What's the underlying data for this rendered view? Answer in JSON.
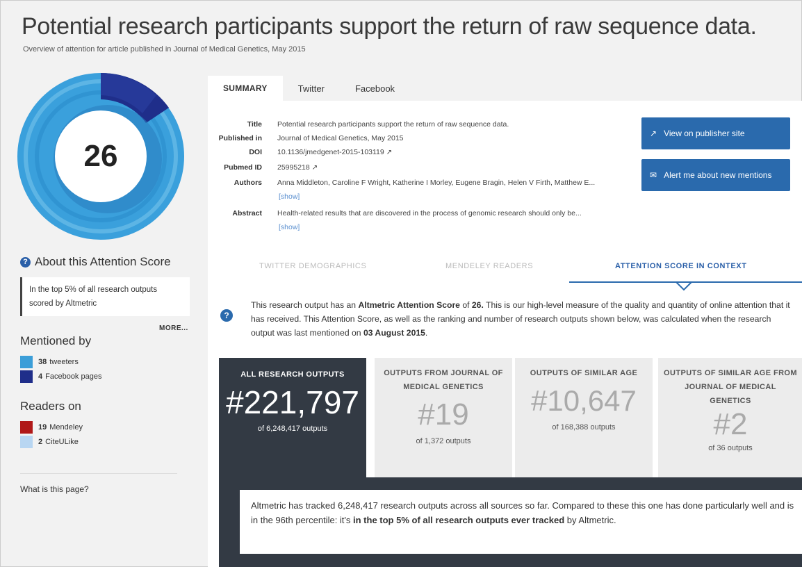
{
  "header": {
    "title": "Potential research participants support the return of raw sequence data.",
    "subtitle": "Overview of attention for article published in Journal of Medical Genetics, May 2015"
  },
  "sidebar": {
    "score": "26",
    "about_title": "About this Attention Score",
    "about_box": "In the top 5% of all research outputs scored by Altmetric",
    "more": "MORE...",
    "mentioned_heading": "Mentioned by",
    "mentioned": [
      {
        "count": "38",
        "label": "tweeters",
        "color": "#3b9ed8"
      },
      {
        "count": "4",
        "label": "Facebook pages",
        "color": "#1f2e8a"
      }
    ],
    "readers_heading": "Readers on",
    "readers": [
      {
        "count": "19",
        "label": "Mendeley",
        "color": "#b01818"
      },
      {
        "count": "2",
        "label": "CiteULike",
        "color": "#b8d6f2"
      }
    ],
    "what_link": "What is this page?"
  },
  "tabs": [
    {
      "label": "SUMMARY",
      "active": true
    },
    {
      "label": "Twitter",
      "active": false
    },
    {
      "label": "Facebook",
      "active": false
    }
  ],
  "meta": {
    "title_label": "Title",
    "title_value": "Potential research participants support the return of raw sequence data.",
    "published_label": "Published in",
    "published_value": "Journal of Medical Genetics, May 2015",
    "doi_label": "DOI",
    "doi_value": "10.1136/jmedgenet-2015-103119",
    "pubmed_label": "Pubmed ID",
    "pubmed_value": "25995218",
    "authors_label": "Authors",
    "authors_value": "Anna Middleton, Caroline F Wright, Katherine I Morley, Eugene Bragin, Helen V Firth, Matthew E...",
    "abstract_label": "Abstract",
    "abstract_value": "Health-related results that are discovered in the process of genomic research should only be...",
    "show": "[show]"
  },
  "buttons": {
    "publisher": "View on publisher site",
    "alert": "Alert me about new mentions"
  },
  "subtabs": {
    "twitter_demo": "TWITTER DEMOGRAPHICS",
    "mendeley": "MENDELEY READERS",
    "context": "ATTENTION SCORE IN CONTEXT"
  },
  "context": {
    "part1": "This research output has an ",
    "bold1": "Altmetric Attention Score",
    "part2": " of ",
    "bold2": "26.",
    "part3": " This is our high-level measure of the quality and quantity of online attention that it has received. This Attention Score, as well as the ranking and number of research outputs shown below, was calculated when the research output was last mentioned on ",
    "bold3": "03 August 2015",
    "part4": "."
  },
  "cards": [
    {
      "heading": "ALL RESEARCH OUTPUTS",
      "rank": "#221,797",
      "of": "of 6,248,417 outputs"
    },
    {
      "heading": "OUTPUTS FROM JOURNAL OF MEDICAL GENETICS",
      "rank": "#19",
      "of": "of 1,372 outputs"
    },
    {
      "heading": "OUTPUTS OF SIMILAR AGE",
      "rank": "#10,647",
      "of": "of 168,388 outputs"
    },
    {
      "heading": "OUTPUTS OF SIMILAR AGE FROM JOURNAL OF MEDICAL GENETICS",
      "rank": "#2",
      "of": "of 36 outputs"
    }
  ],
  "summary": {
    "part1": "Altmetric has tracked 6,248,417 research outputs across all sources so far. Compared to these this one has done particularly well and is in the 96th percentile: it's ",
    "bold": "in the top 5% of all research outputs ever tracked",
    "part2": " by Altmetric."
  }
}
